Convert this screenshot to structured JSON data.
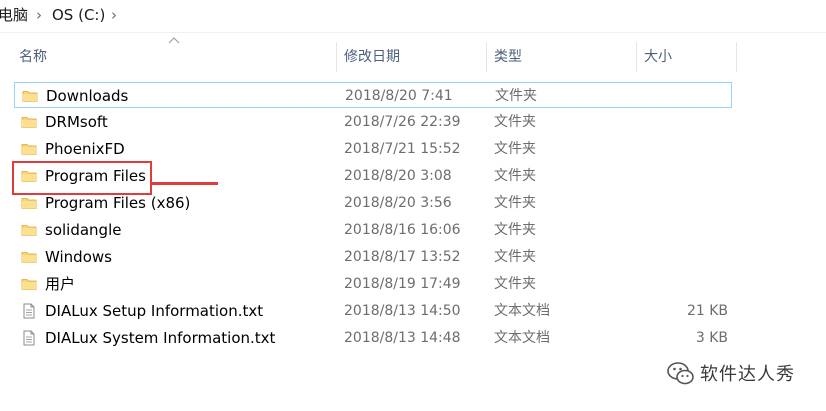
{
  "breadcrumb": {
    "items": [
      "电脑",
      "OS (C:)"
    ]
  },
  "columns": {
    "name": "名称",
    "modified": "修改日期",
    "type": "类型",
    "size": "大小"
  },
  "files": [
    {
      "name": "Downloads",
      "date": "2018/8/20 7:41",
      "type": "文件夹",
      "size": "",
      "icon": "folder-icon",
      "selected": true
    },
    {
      "name": "DRMsoft",
      "date": "2018/7/26 22:39",
      "type": "文件夹",
      "size": "",
      "icon": "folder-icon"
    },
    {
      "name": "PhoenixFD",
      "date": "2018/7/21 15:52",
      "type": "文件夹",
      "size": "",
      "icon": "folder-icon"
    },
    {
      "name": "Program Files",
      "date": "2018/8/20 3:08",
      "type": "文件夹",
      "size": "",
      "icon": "folder-icon",
      "highlighted": true
    },
    {
      "name": "Program Files (x86)",
      "date": "2018/8/20 3:56",
      "type": "文件夹",
      "size": "",
      "icon": "folder-icon"
    },
    {
      "name": "solidangle",
      "date": "2018/8/16 16:06",
      "type": "文件夹",
      "size": "",
      "icon": "folder-icon"
    },
    {
      "name": "Windows",
      "date": "2018/8/17 13:52",
      "type": "文件夹",
      "size": "",
      "icon": "folder-icon"
    },
    {
      "name": "用户",
      "date": "2018/8/19 17:49",
      "type": "文件夹",
      "size": "",
      "icon": "folder-icon"
    },
    {
      "name": "DIALux Setup Information.txt",
      "date": "2018/8/13 14:50",
      "type": "文本文档",
      "size": "21 KB",
      "icon": "text-file-icon"
    },
    {
      "name": "DIALux System Information.txt",
      "date": "2018/8/13 14:48",
      "type": "文本文档",
      "size": "3 KB",
      "icon": "text-file-icon"
    }
  ],
  "watermark": {
    "text": "软件达人秀",
    "icon": "wechat-icon"
  },
  "colors": {
    "highlight": "#e03c3c",
    "selection_border": "#99d1ff",
    "folder": "#f8d775",
    "header_text": "#4c607a"
  }
}
